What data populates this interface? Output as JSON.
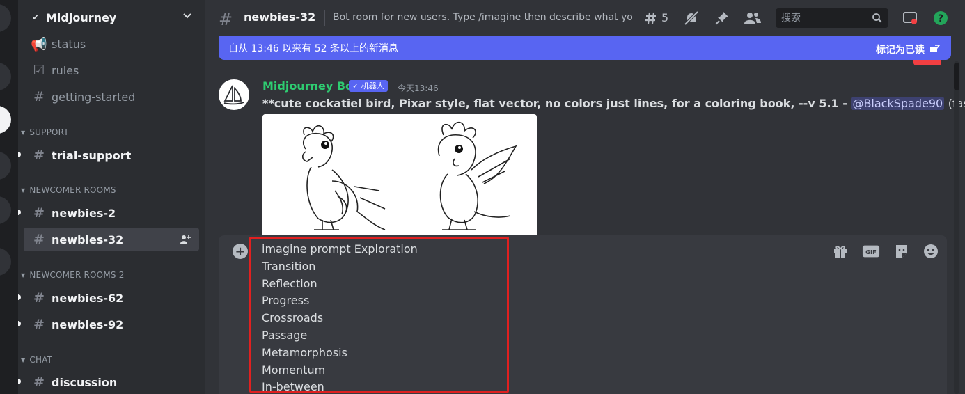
{
  "server": {
    "name": "Midjourney"
  },
  "sidebar": {
    "channels_top": [
      {
        "label": "status"
      },
      {
        "label": "rules"
      },
      {
        "label": "getting-started"
      }
    ],
    "categories": [
      {
        "label": "SUPPORT",
        "channels": [
          {
            "label": "trial-support"
          }
        ]
      },
      {
        "label": "NEWCOMER ROOMS",
        "channels": [
          {
            "label": "newbies-2"
          },
          {
            "label": "newbies-32"
          }
        ]
      },
      {
        "label": "NEWCOMER ROOMS 2",
        "channels": [
          {
            "label": "newbies-62"
          },
          {
            "label": "newbies-92"
          }
        ]
      },
      {
        "label": "CHAT",
        "channels": [
          {
            "label": "discussion"
          }
        ]
      }
    ],
    "selected_channel": "newbies-32"
  },
  "header": {
    "channel_name": "newbies-32",
    "topic": "Bot room for new users. Type /imagine then describe what you...",
    "thread_count": "5",
    "search_placeholder": "搜索"
  },
  "banner": {
    "text": "自从 13:46 以来有 52 条以上的新消息",
    "mark_read": "标记为已读"
  },
  "message": {
    "author": "Midjourney Bot",
    "bot_badge": "✓ 机器人",
    "time": "今天13:46",
    "prompt": "**cute cockatiel bird, Pixar style, flat vector, no colors just lines, for a coloring book, --v 5.1 -",
    "mention": "@BlackSpade90",
    "speed": "(fast)"
  },
  "composer": {
    "lines": [
      "imagine prompt Exploration",
      "Transition",
      "Reflection",
      "Progress",
      "Crossroads",
      "Passage",
      "Metamorphosis",
      "Momentum",
      "In-between"
    ],
    "gif_label": "GIF"
  },
  "colors": {
    "accent": "#5865f2",
    "bot_name": "#2ecc71",
    "highlight_box": "#e02020",
    "help": "#23a55a"
  }
}
